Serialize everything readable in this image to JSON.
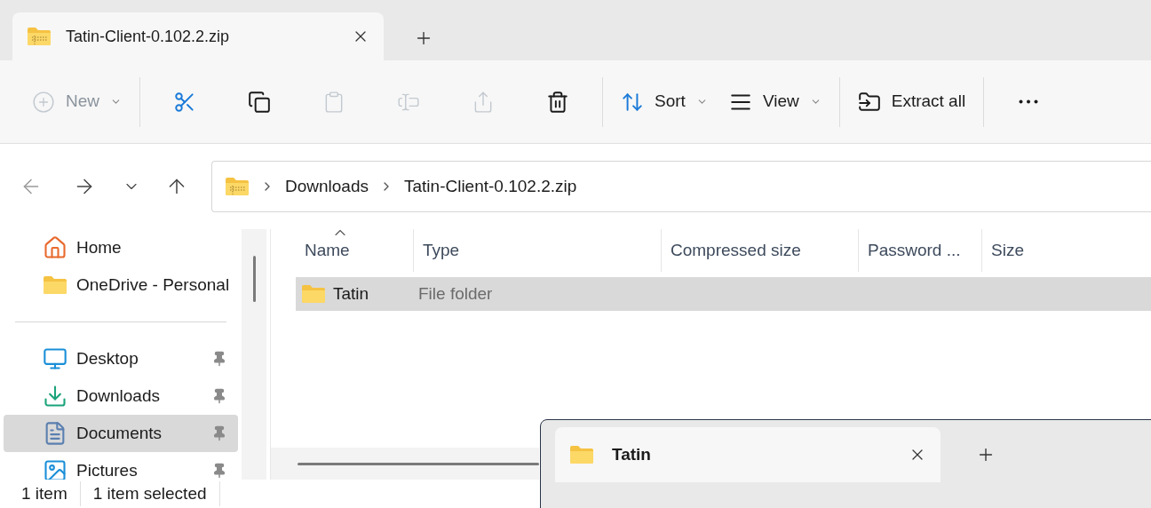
{
  "tabs": [
    {
      "label": "Tatin-Client-0.102.2.zip",
      "selected": true
    }
  ],
  "toolbar": [
    {
      "kind": "menu",
      "label": "New",
      "disabled": true
    },
    {
      "kind": "cut",
      "disabled": false
    },
    {
      "kind": "copy",
      "disabled": false
    },
    {
      "kind": "paste",
      "disabled": true
    },
    {
      "kind": "rename",
      "disabled": true
    },
    {
      "kind": "share",
      "disabled": true
    },
    {
      "kind": "delete",
      "disabled": false
    },
    {
      "kind": "sort",
      "label": "Sort",
      "disabled": false
    },
    {
      "kind": "view",
      "label": "View",
      "disabled": false
    },
    {
      "kind": "extract",
      "label": "Extract all",
      "disabled": false
    },
    {
      "kind": "more",
      "disabled": false
    }
  ],
  "breadcrumb": [
    "Downloads",
    "Tatin-Client-0.102.2.zip"
  ],
  "sidebar": {
    "top": [
      {
        "kind": "home",
        "label": "Home",
        "selected": false
      },
      {
        "kind": "cloud",
        "label": "OneDrive - Personal",
        "selected": false
      }
    ],
    "pinned": [
      {
        "kind": "desktop",
        "label": "Desktop",
        "selected": false,
        "pinned": true
      },
      {
        "kind": "downloads",
        "label": "Downloads",
        "selected": false,
        "pinned": true
      },
      {
        "kind": "documents",
        "label": "Documents",
        "selected": true,
        "pinned": true
      },
      {
        "kind": "pictures",
        "label": "Pictures",
        "selected": false,
        "pinned": true
      }
    ]
  },
  "table": {
    "columns": [
      {
        "label": "Name",
        "sorted": true
      },
      {
        "label": "Type",
        "sorted": false
      },
      {
        "label": "Compressed size",
        "sorted": false
      },
      {
        "label": "Password ...",
        "sorted": false
      },
      {
        "label": "Size",
        "sorted": false
      }
    ],
    "rows": [
      {
        "name": "Tatin",
        "type": "File folder",
        "selected": true
      }
    ]
  },
  "status_bar": [
    "1 item",
    "1 item selected"
  ],
  "second_window": {
    "tabs": [
      {
        "label": "Tatin",
        "selected": true
      }
    ]
  }
}
